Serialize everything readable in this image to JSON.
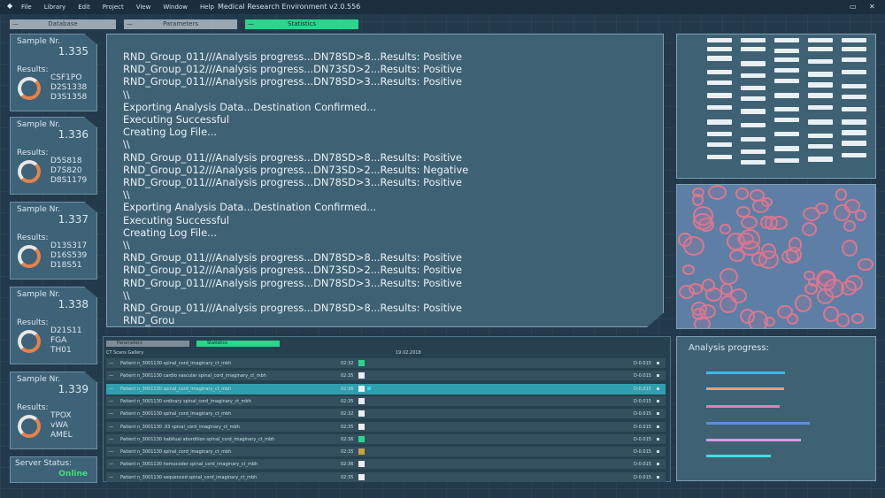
{
  "menubar": {
    "items": [
      "File",
      "Library",
      "Edit",
      "Project",
      "View",
      "Window",
      "Help"
    ],
    "title": "Medical Research Environment v2.0.556",
    "minimize": "▭",
    "close": "✕"
  },
  "tabs": [
    {
      "label": "Database",
      "state": "gray"
    },
    {
      "label": "Parameters",
      "state": "gray"
    },
    {
      "label": "Statistics",
      "state": "active"
    }
  ],
  "samples": [
    {
      "label": "Sample Nr.",
      "number": "1.335",
      "results_label": "Results:",
      "codes": [
        "CSF1PO",
        "D2S1338",
        "D3S1358"
      ]
    },
    {
      "label": "Sample Nr.",
      "number": "1.336",
      "results_label": "Results:",
      "codes": [
        "D5S818",
        "D7S820",
        "D8S1179"
      ]
    },
    {
      "label": "Sample Nr.",
      "number": "1.337",
      "results_label": "Results:",
      "codes": [
        "D13S317",
        "D16S539",
        "D18S51"
      ]
    },
    {
      "label": "Sample Nr.",
      "number": "1.338",
      "results_label": "Results:",
      "codes": [
        "D21S11",
        "FGA",
        "TH01"
      ]
    },
    {
      "label": "Sample Nr.",
      "number": "1.339",
      "results_label": "Results:",
      "codes": [
        "TPOX",
        "vWA",
        "AMEL"
      ]
    }
  ],
  "server": {
    "label": "Server Status:",
    "value": "Online"
  },
  "console": {
    "lines": [
      "RND_Group_011///Analysis progress...DN78SD>8...Results: Positive",
      "RND_Group_012///Analysis progress...DN73SD>2...Results: Positive",
      "RND_Group_011///Analysis progress...DN78SD>3...Results: Positive",
      "\\\\",
      "Exporting Analysis Data...Destination Confirmed...",
      "Executing Successful",
      "Creating Log File...",
      "\\\\",
      "RND_Group_011///Analysis progress...DN78SD>8...Results: Positive",
      "RND_Group_012///Analysis progress...DN73SD>2...Results: Negative",
      "RND_Group_011///Analysis progress...DN78SD>3...Results: Positive",
      "\\\\",
      "Exporting Analysis Data...Destination Confirmed...",
      "Executing Successful",
      "Creating Log File...",
      "\\\\",
      "RND_Group_011///Analysis progress...DN78SD>8...Results: Positive",
      "RND_Group_012///Analysis progress...DN73SD>2...Results: Positive",
      "RND_Group_011///Analysis progress...DN78SD>3...Results: Positive",
      "\\\\",
      "RND_Group_011///Analysis progress...DN78SD>8...Results: Positive",
      "RND_Grou"
    ]
  },
  "bottom": {
    "tabs": [
      "Parameters",
      "Statistics"
    ],
    "gallery_label": "CT Scans Gallery",
    "date": "19.02.2018",
    "rows": [
      {
        "name": "Patient n_3001130 spinal_cord_imaginary_ct_mbh",
        "time": "02:32",
        "color": "#2ad58c",
        "code": "D-0.015",
        "selected": false
      },
      {
        "name": "Patient n_3001130 cardio vascular spinal_cord_imaginary_ct_mbh",
        "time": "02:35",
        "color": "#e8eef2",
        "code": "D-0.015",
        "selected": false
      },
      {
        "name": "Patient n_3001130 spinal_cord_imaginary_ct_mbh",
        "time": "02:36",
        "color": "#e8eef2",
        "code": "D-0.015",
        "selected": true
      },
      {
        "name": "Patient n_3001130 ordinary spinal_cord_imaginary_ct_mbh",
        "time": "02:35",
        "color": "#e8eef2",
        "code": "D-0.015",
        "selected": false
      },
      {
        "name": "Patient n_3001130 spinal_cord_imaginary_ct_mbh",
        "time": "02:32",
        "color": "#e8eef2",
        "code": "D-0.015",
        "selected": false
      },
      {
        "name": "Patient n_3001130 .03 spinal_cord_imaginary_ct_mbh",
        "time": "02:35",
        "color": "#e8eef2",
        "code": "D-0.015",
        "selected": false
      },
      {
        "name": "Patient n_3001130 habitual abordition spinal_cord_imaginary_ct_mbh",
        "time": "02:36",
        "color": "#2ad58c",
        "code": "D-0.015",
        "selected": false
      },
      {
        "name": "Patient n_3001130 spinal_cord_imaginary_ct_mbh",
        "time": "02:35",
        "color": "#c9a33b",
        "code": "D-0.015",
        "selected": false
      },
      {
        "name": "Patient n_3001130 hemocoder spinal_cord_imaginary_ct_mbh",
        "time": "02:36",
        "color": "#e8eef2",
        "code": "D-0.015",
        "selected": false
      },
      {
        "name": "Patient n_3001130 sequenced spinal_cord_imaginary_ct_mbh",
        "time": "02:35",
        "color": "#e8eef2",
        "code": "D-0.015",
        "selected": false
      }
    ]
  },
  "analysis": {
    "title": "Analysis progress:",
    "bars": [
      {
        "color": "#3fb6e8",
        "level": 0.72
      },
      {
        "color": "#e8a070",
        "level": 0.71
      },
      {
        "color": "#e07fb5",
        "level": 0.67
      },
      {
        "color": "#5a8ee8",
        "level": 0.94
      },
      {
        "color": "#d79be6",
        "level": 0.86
      },
      {
        "color": "#45dbe0",
        "level": 0.59
      }
    ]
  }
}
